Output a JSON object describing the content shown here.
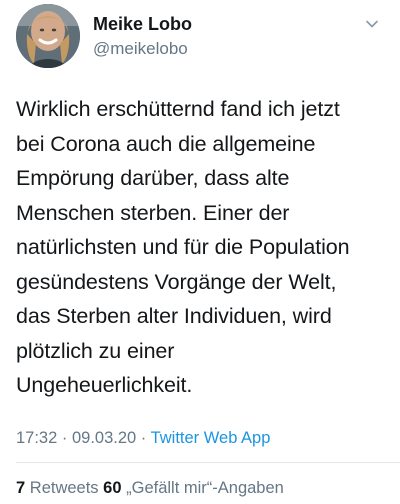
{
  "user": {
    "display_name": "Meike Lobo",
    "handle": "@meikelobo"
  },
  "tweet": {
    "lines": [
      "Wirklich erschütternd fand ich jetzt",
      "bei Corona auch die allgemeine",
      "Empörung darüber, dass alte",
      "Menschen sterben. Einer der",
      "natürlichsten und für die Population",
      "gesündestens Vorgänge der Welt,",
      "das Sterben alter Individuen, wird",
      "plötzlich zu einer",
      "Ungeheuerlichkeit."
    ]
  },
  "meta": {
    "time": "17:32",
    "separator1": " · ",
    "date": "09.03.20",
    "separator2": " · ",
    "source": "Twitter Web App"
  },
  "stats": {
    "retweets_count": "7",
    "retweets_label": "Retweets",
    "likes_count": "60",
    "likes_label": "„Gefällt mir“-Angaben"
  },
  "icons": {
    "menu": "chevron-down-icon",
    "avatar": "profile-photo"
  },
  "colors": {
    "text_primary": "#14171a",
    "text_secondary": "#657786",
    "link": "#1b95e0",
    "divider": "#e1e8ed"
  }
}
